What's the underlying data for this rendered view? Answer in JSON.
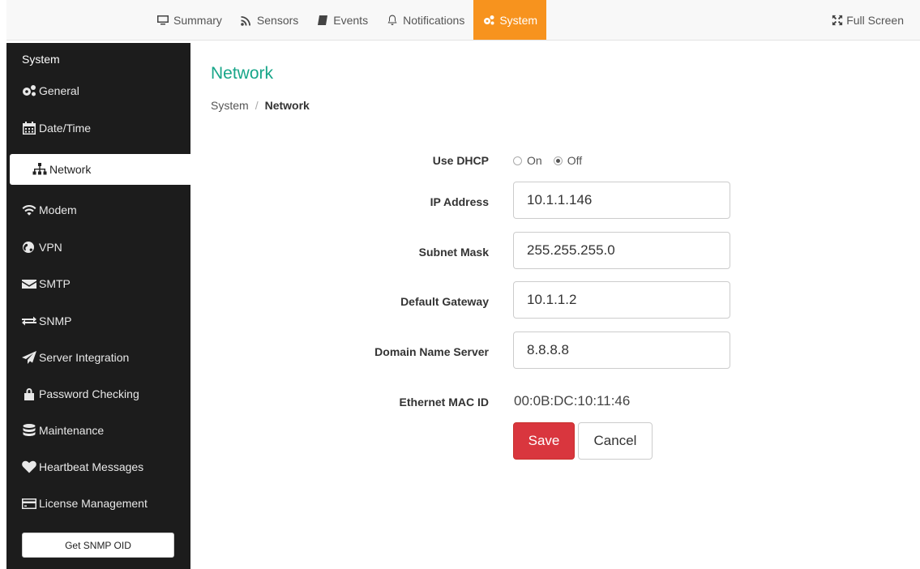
{
  "topnav": {
    "items": [
      {
        "label": "Summary",
        "icon": "monitor-icon"
      },
      {
        "label": "Sensors",
        "icon": "rss-icon"
      },
      {
        "label": "Events",
        "icon": "book-icon"
      },
      {
        "label": "Notifications",
        "icon": "bell-icon"
      },
      {
        "label": "System",
        "icon": "gears-icon",
        "active": true
      }
    ],
    "fullscreen_label": "Full Screen",
    "active_color": "#f7931e"
  },
  "sidebar": {
    "title": "System",
    "items": [
      {
        "label": "General",
        "icon": "gears-icon"
      },
      {
        "label": "Date/Time",
        "icon": "calendar-icon"
      },
      {
        "label": "Network",
        "icon": "sitemap-icon",
        "active": true
      },
      {
        "label": "Modem",
        "icon": "wifi-icon"
      },
      {
        "label": "VPN",
        "icon": "globe-icon"
      },
      {
        "label": "SMTP",
        "icon": "envelope-icon"
      },
      {
        "label": "SNMP",
        "icon": "exchange-icon"
      },
      {
        "label": "Server Integration",
        "icon": "paper-plane-icon"
      },
      {
        "label": "Password Checking",
        "icon": "lock-icon"
      },
      {
        "label": "Maintenance",
        "icon": "database-icon"
      },
      {
        "label": "Heartbeat Messages",
        "icon": "heart-icon"
      },
      {
        "label": "License Management",
        "icon": "credit-card-icon"
      }
    ],
    "button_label": "Get SNMP OID"
  },
  "main": {
    "title": "Network",
    "title_color": "#18a689",
    "breadcrumb": {
      "root": "System",
      "separator": "/",
      "current": "Network"
    },
    "form": {
      "dhcp": {
        "label": "Use DHCP",
        "on_label": "On",
        "off_label": "Off",
        "selected": "Off"
      },
      "ip": {
        "label": "IP Address",
        "value": "10.1.1.146"
      },
      "subnet": {
        "label": "Subnet Mask",
        "value": "255.255.255.0"
      },
      "gateway": {
        "label": "Default Gateway",
        "value": "10.1.1.2"
      },
      "dns": {
        "label": "Domain Name Server",
        "value": "8.8.8.8"
      },
      "mac": {
        "label": "Ethernet MAC ID",
        "value": "00:0B:DC:10:11:46"
      }
    },
    "buttons": {
      "save": "Save",
      "cancel": "Cancel",
      "save_color": "#d9363e"
    }
  }
}
